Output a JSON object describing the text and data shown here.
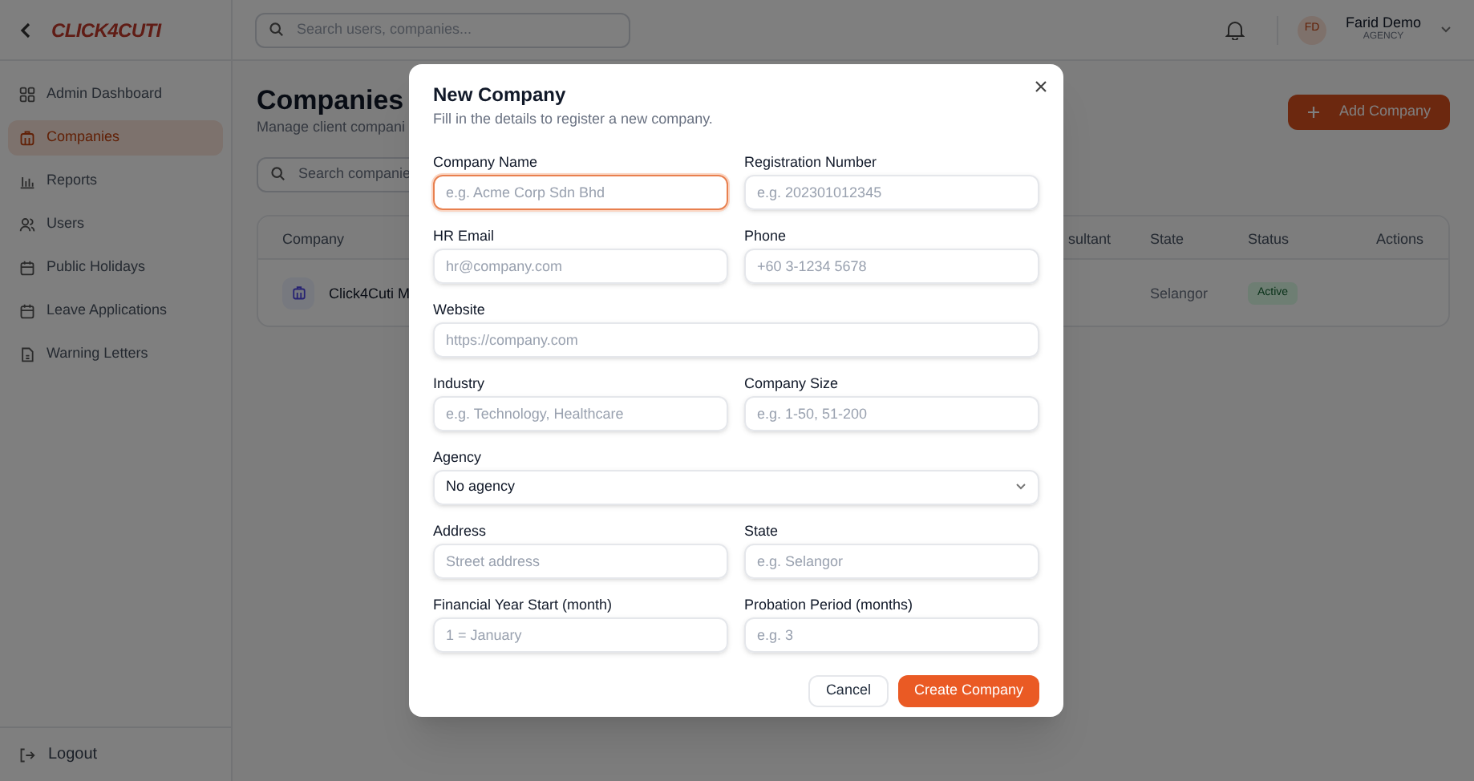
{
  "sidebar": {
    "logo": "CLICK4CUTI",
    "items": [
      {
        "label": "Admin Dashboard",
        "selected": false
      },
      {
        "label": "Companies",
        "selected": true
      },
      {
        "label": "Reports",
        "selected": false
      },
      {
        "label": "Users",
        "selected": false
      },
      {
        "label": "Public Holidays",
        "selected": false
      },
      {
        "label": "Leave Applications",
        "selected": false
      },
      {
        "label": "Warning Letters",
        "selected": false
      }
    ],
    "logout": "Logout"
  },
  "header": {
    "search_placeholder": "Search users, companies...",
    "user": {
      "initials": "FD",
      "name": "Farid Demo",
      "role": "AGENCY"
    }
  },
  "page": {
    "title": "Companies",
    "subtitle": "Manage client compani",
    "add_button": "Add Company",
    "search_placeholder": "Search companie",
    "table": {
      "columns": [
        "Company",
        "sultant",
        "State",
        "Status",
        "Actions"
      ],
      "rows": [
        {
          "company": "Click4Cuti M",
          "state": "Selangor",
          "status": "Active"
        }
      ]
    }
  },
  "dialog": {
    "title": "New Company",
    "subtitle": "Fill in the details to register a new company.",
    "fields": [
      {
        "label": "Company Name",
        "placeholder": "e.g. Acme Corp Sdn Bhd",
        "kind": "input",
        "focused": true
      },
      {
        "label": "Registration Number",
        "placeholder": "e.g. 202301012345",
        "kind": "input",
        "focused": false
      },
      {
        "label": "HR Email",
        "placeholder": "hr@company.com",
        "kind": "input",
        "focused": false
      },
      {
        "label": "Phone",
        "placeholder": "+60 3-1234 5678",
        "kind": "input",
        "focused": false
      },
      {
        "label": "Website",
        "placeholder": "https://company.com",
        "kind": "input",
        "focused": false
      },
      {
        "label": "Industry",
        "placeholder": "e.g. Technology, Healthcare",
        "kind": "input",
        "focused": false
      },
      {
        "label": "Company Size",
        "placeholder": "e.g. 1-50, 51-200",
        "kind": "input",
        "focused": false
      },
      {
        "label": "Agency",
        "value": "No agency",
        "kind": "select",
        "focused": false
      },
      {
        "label": "Address",
        "placeholder": "Street address",
        "kind": "input",
        "focused": false
      },
      {
        "label": "State",
        "placeholder": "e.g. Selangor",
        "kind": "input",
        "focused": false
      },
      {
        "label": "Financial Year Start (month)",
        "placeholder": "1 = January",
        "kind": "input",
        "focused": false
      },
      {
        "label": "Probation Period (months)",
        "placeholder": "e.g. 3",
        "kind": "input",
        "focused": false
      }
    ],
    "cancel": "Cancel",
    "submit": "Create Company"
  }
}
